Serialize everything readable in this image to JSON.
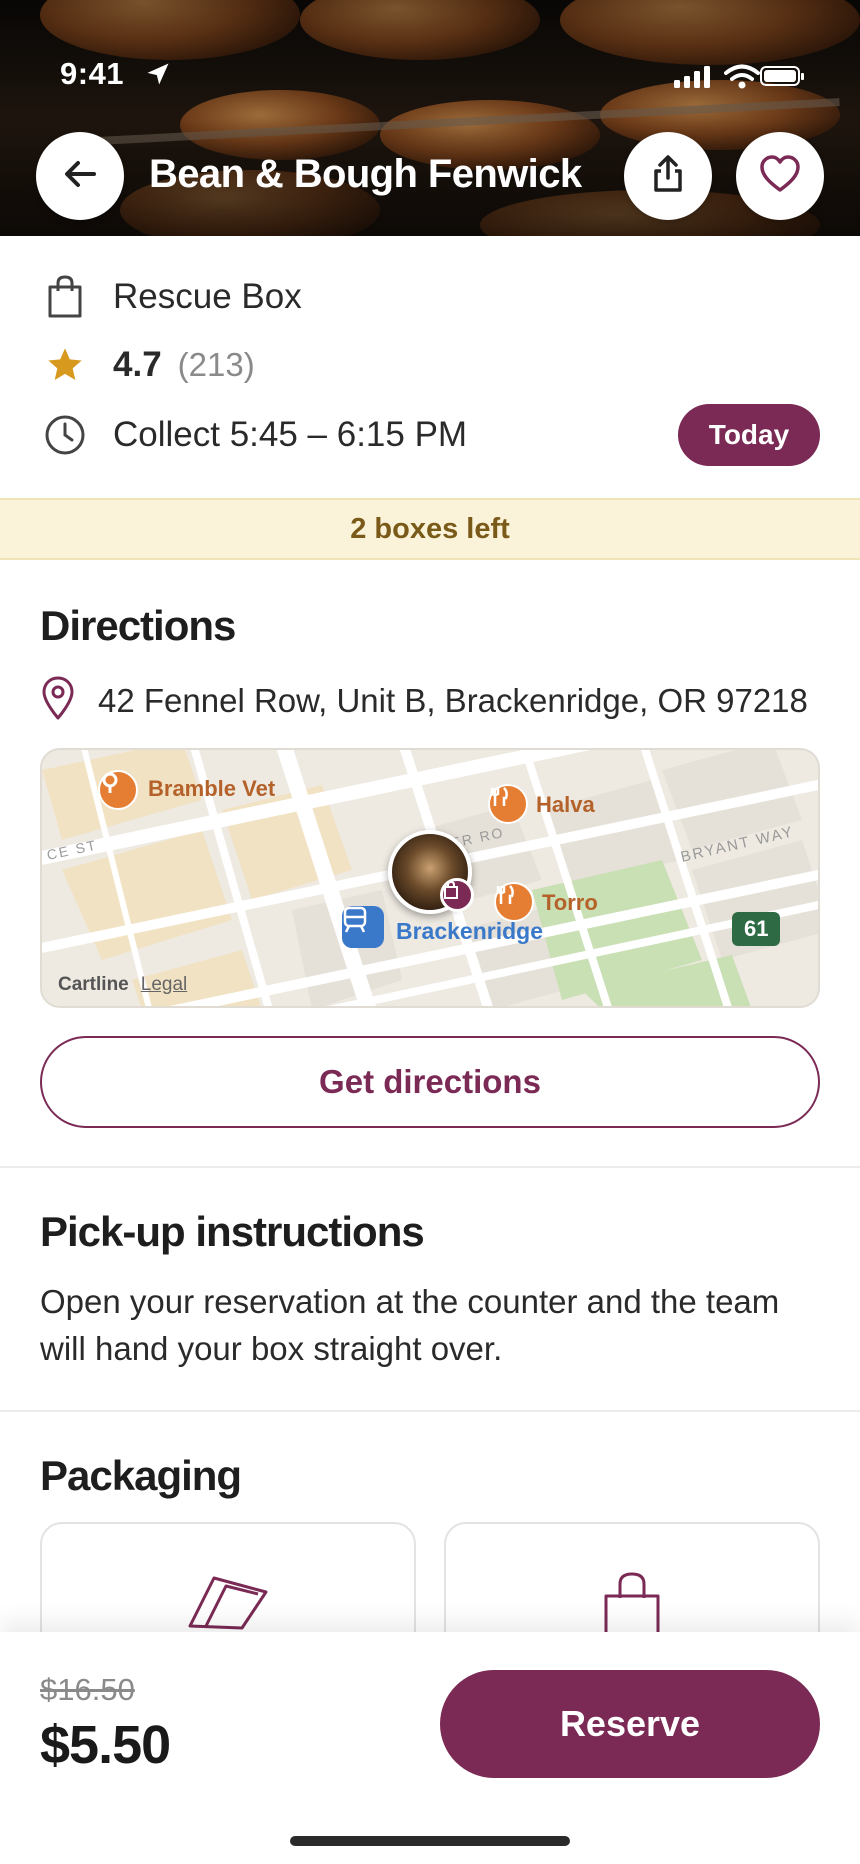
{
  "status_bar": {
    "time": "9:41"
  },
  "header": {
    "title": "Bean & Bough Fenwick"
  },
  "offer": {
    "name": "Rescue Box",
    "rating": "4.7",
    "rating_count": "(213)",
    "collect_time": "Collect 5:45 – 6:15 PM",
    "day_badge": "Today",
    "stock": "2 boxes left"
  },
  "directions": {
    "title": "Directions",
    "address": "42 Fennel Row, Unit B, Brackenridge, OR 97218",
    "button": "Get directions",
    "map": {
      "poi_vet": "Bramble Vet",
      "poi_halva": "Halva",
      "poi_torro": "Torro",
      "station": "Brackenridge",
      "street_bryant": "BRYANT WAY",
      "street_ce": "CE ST",
      "street_er": "ER RO",
      "route_badge": "61",
      "attribution": "Cartline",
      "legal": "Legal"
    }
  },
  "pickup": {
    "title": "Pick-up instructions",
    "text": "Open your reservation at the counter and the team will hand your box straight over."
  },
  "packaging": {
    "title": "Packaging"
  },
  "footer": {
    "old_price": "$16.50",
    "price": "$5.50",
    "reserve": "Reserve"
  },
  "colors": {
    "brand": "#7a2a54",
    "banner_bg": "#fbf3d9",
    "banner_text": "#7a5a18",
    "star": "#d79a1e"
  }
}
